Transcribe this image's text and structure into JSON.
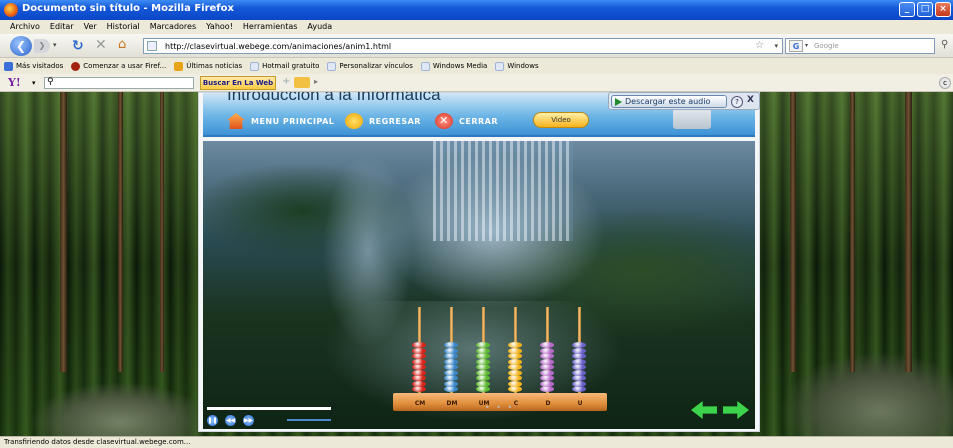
{
  "window": {
    "title": "Documento sin título - Mozilla Firefox"
  },
  "menu": [
    "Archivo",
    "Editar",
    "Ver",
    "Historial",
    "Marcadores",
    "Yahoo!",
    "Herramientas",
    "Ayuda"
  ],
  "nav": {
    "url": "http://clasevirtual.webege.com/animaciones/anim1.html",
    "search_placeholder": "Google",
    "search_engine_icon": "G"
  },
  "bookmarks": [
    {
      "label": "Más visitados",
      "icon_color": "#3a6fd8"
    },
    {
      "label": "Comenzar a usar Firef...",
      "icon_color": "#a3220f"
    },
    {
      "label": "Últimas noticias",
      "icon_color": "#e8a317"
    },
    {
      "label": "Hotmail gratuito",
      "icon_color": "#9fb6d6"
    },
    {
      "label": "Personalizar vínculos",
      "icon_color": "#9fb6d6"
    },
    {
      "label": "Windows Media",
      "icon_color": "#9fb6d6"
    },
    {
      "label": "Windows",
      "icon_color": "#9fb6d6"
    }
  ],
  "yahoo": {
    "logo": "Y!",
    "search_button": "Buscar En La Web"
  },
  "panel": {
    "title": "Introducción a la Informática",
    "menu_principal": "MENU PRINCIPAL",
    "regresar": "REGRESAR",
    "cerrar": "CERRAR",
    "video": "Video",
    "audio_button": "Descargar este audio",
    "audio_help": "?",
    "audio_close": "X"
  },
  "abacus": {
    "columns": [
      {
        "label": "CM",
        "color": "#d8241a"
      },
      {
        "label": "DM",
        "color": "#3a86c8"
      },
      {
        "label": "UM",
        "color": "#5cb82e"
      },
      {
        "label": "C",
        "color": "#f2b21a"
      },
      {
        "label": "D",
        "color": "#b66ac8"
      },
      {
        "label": "U",
        "color": "#6a5ec8"
      }
    ],
    "beads_per_column": 9
  },
  "status": "Transfiriendo datos desde clasevirtual.webege.com..."
}
